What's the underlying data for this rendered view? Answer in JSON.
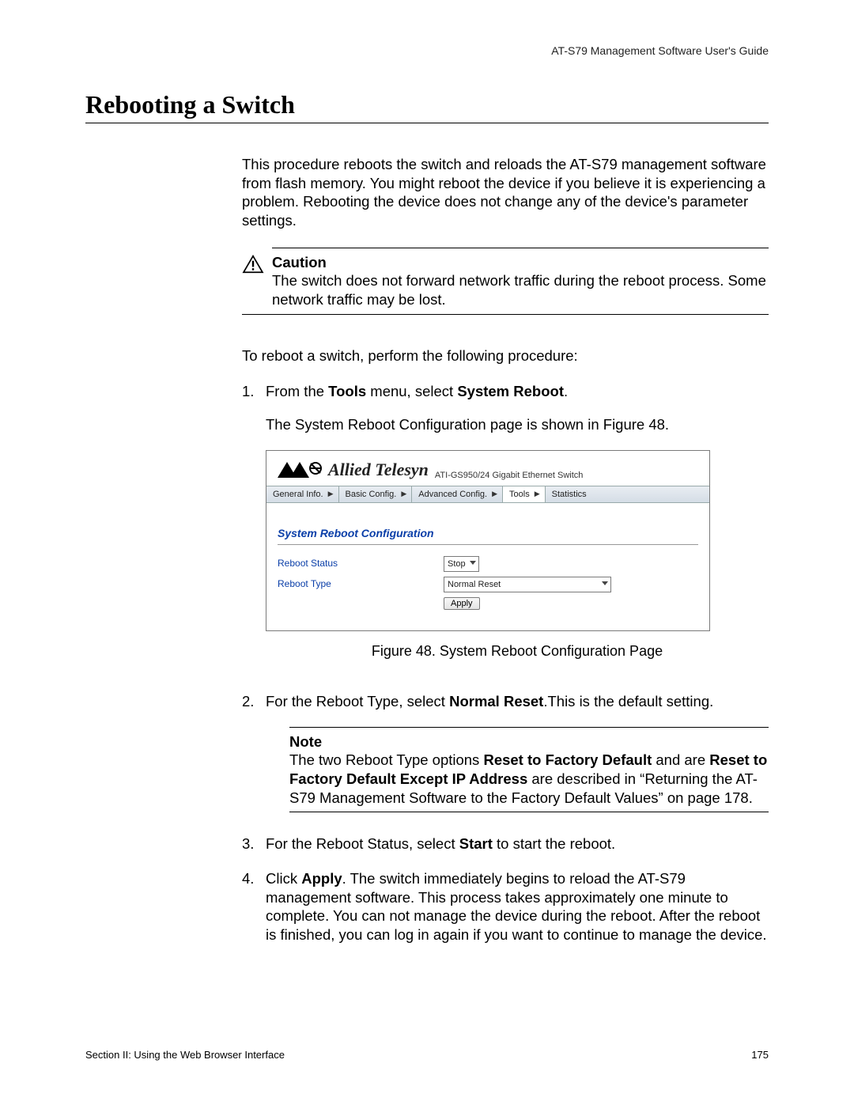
{
  "header": {
    "running_head": "AT-S79 Management Software User's Guide"
  },
  "title": "Rebooting a Switch",
  "intro": "This procedure reboots the switch and reloads the AT-S79 management software from flash memory. You might reboot the device if you believe it is experiencing a problem. Rebooting the device does not change any of the device's parameter settings.",
  "caution": {
    "label": "Caution",
    "text": "The switch does not forward network traffic during the reboot process. Some network traffic may be lost."
  },
  "lead_in": "To reboot a switch, perform the following procedure:",
  "steps": {
    "s1": {
      "num": "1.",
      "pre": "From the ",
      "bold1": "Tools",
      "mid": " menu, select ",
      "bold2": "System Reboot",
      "post": ".",
      "after": "The System Reboot Configuration page is shown in Figure 48."
    },
    "s2": {
      "num": "2.",
      "pre": "For the Reboot Type, select ",
      "bold1": "Normal Reset",
      "post": ".This is the default setting."
    },
    "s3": {
      "num": "3.",
      "pre": "For the Reboot Status, select ",
      "bold1": "Start",
      "post": " to start the reboot."
    },
    "s4": {
      "num": "4.",
      "pre": "Click ",
      "bold1": "Apply",
      "post": ". The switch immediately begins to reload the AT-S79 management software. This process takes approximately one minute to complete. You can not manage the device during the reboot. After the reboot is finished, you can log in again if you want to continue to manage the device."
    }
  },
  "note": {
    "label": "Note",
    "pre": "The two Reboot Type options ",
    "bold1": "Reset to Factory Default",
    "mid1": " and are ",
    "bold2": "Reset to Factory Default Except IP Address",
    "mid2": " are described in “Returning the AT-S79 Management Software to the Factory Default Values” on page 178."
  },
  "figure": {
    "caption": "Figure 48. System Reboot Configuration Page",
    "brand": "Allied Telesyn",
    "model": "ATI-GS950/24 Gigabit Ethernet Switch",
    "menu": {
      "general": "General Info.",
      "basic": "Basic Config.",
      "advanced": "Advanced Config.",
      "tools": "Tools",
      "stats": "Statistics"
    },
    "panel_title": "System Reboot Configuration",
    "reboot_status_label": "Reboot Status",
    "reboot_type_label": "Reboot Type",
    "reboot_status_value": "Stop",
    "reboot_type_value": "Normal Reset",
    "apply_label": "Apply"
  },
  "footer": {
    "left": "Section II: Using the Web Browser Interface",
    "right": "175"
  }
}
